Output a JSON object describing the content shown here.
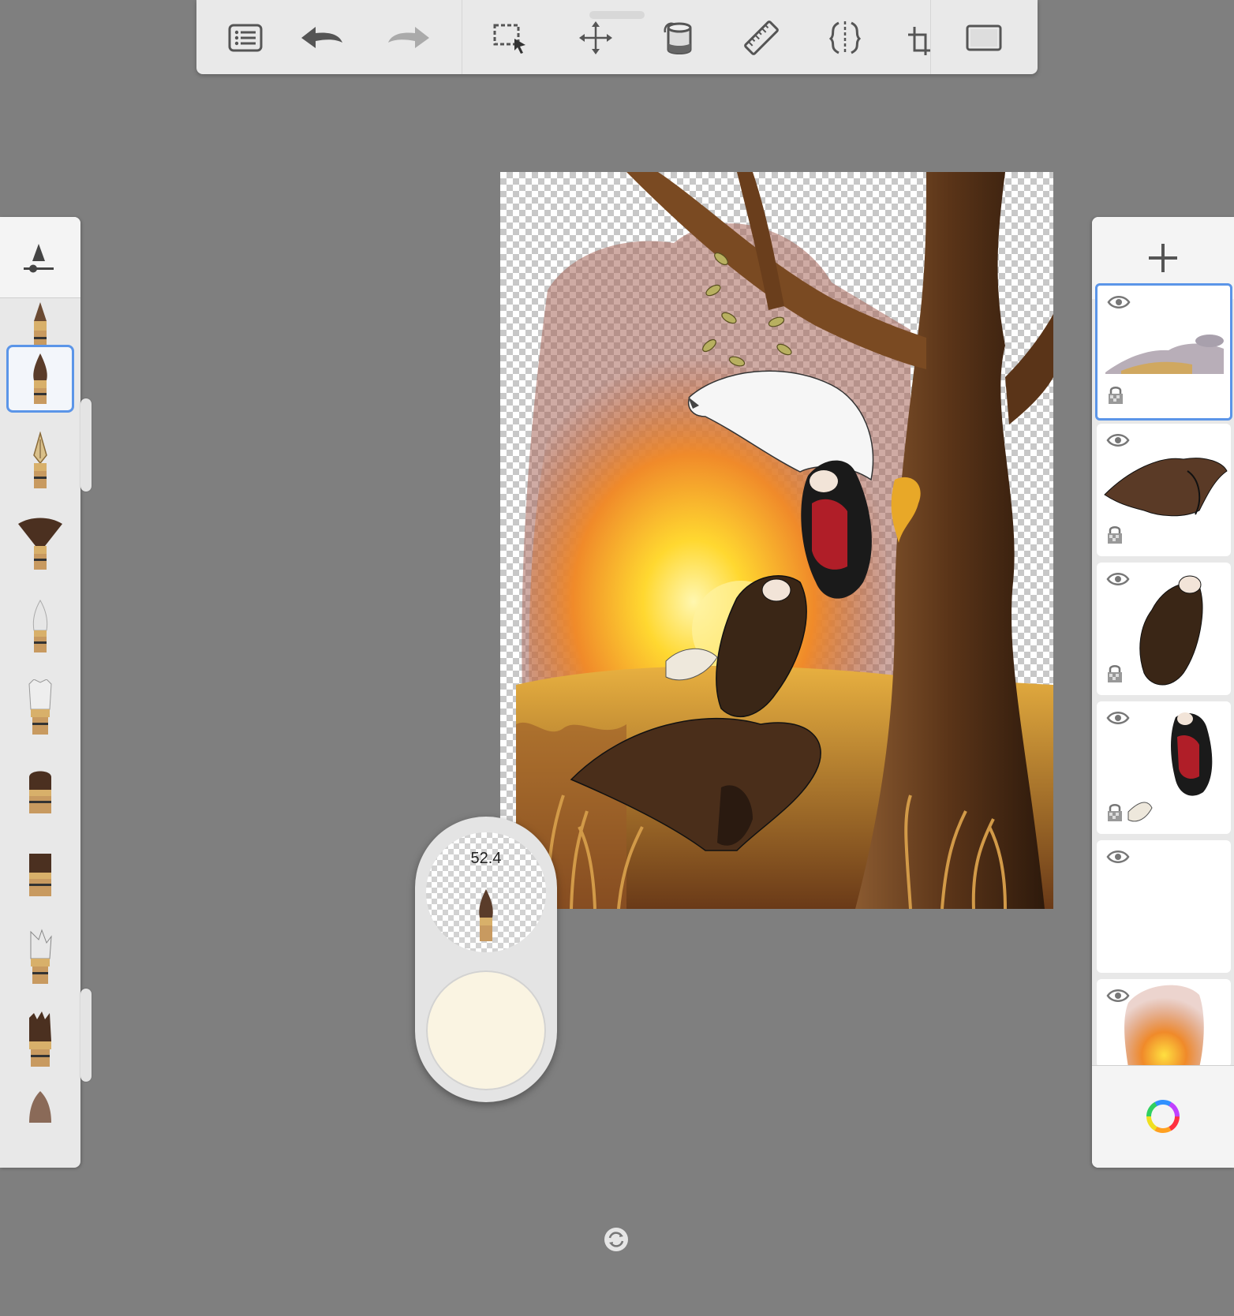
{
  "toolbar": {
    "buttons": [
      {
        "name": "menu-list-icon"
      },
      {
        "name": "undo-icon"
      },
      {
        "name": "redo-icon"
      },
      {
        "name": "selection-icon"
      },
      {
        "name": "transform-move-icon"
      },
      {
        "name": "fill-bucket-icon"
      },
      {
        "name": "ruler-icon"
      },
      {
        "name": "symmetry-icon"
      },
      {
        "name": "crop-icon"
      },
      {
        "name": "fullscreen-icon"
      }
    ]
  },
  "brush_panel": {
    "header_icon": "brush-properties-icon",
    "brushes": [
      "pencil-brush",
      "marker-brush",
      "fountain-pen-brush",
      "fan-brush",
      "airbrush",
      "paint-brush",
      "flat-brush",
      "chisel-brush",
      "splatter-brush",
      "dry-brush",
      "tip-brush"
    ],
    "selected_index": 1
  },
  "puck": {
    "brush_size": "52.4",
    "current_color": "#faf4e2"
  },
  "layers_panel": {
    "add_icon": "plus-icon",
    "layers": [
      {
        "thumb": "rocks",
        "visible": true,
        "locked": true,
        "selected": true
      },
      {
        "thumb": "gryphon-wings",
        "visible": true,
        "locked": true,
        "selected": false
      },
      {
        "thumb": "dark-bird",
        "visible": true,
        "locked": true,
        "selected": false
      },
      {
        "thumb": "red-bird",
        "visible": true,
        "locked": true,
        "selected": false
      },
      {
        "thumb": "blank",
        "visible": true,
        "locked": false,
        "selected": false
      },
      {
        "thumb": "sunset-fire",
        "visible": true,
        "locked": false,
        "selected": false
      }
    ],
    "color_wheel_icon": "color-wheel-icon"
  },
  "colors": {
    "accent": "#5b95e8",
    "background": "#7f7f7f",
    "panel": "#e8e8e8"
  }
}
